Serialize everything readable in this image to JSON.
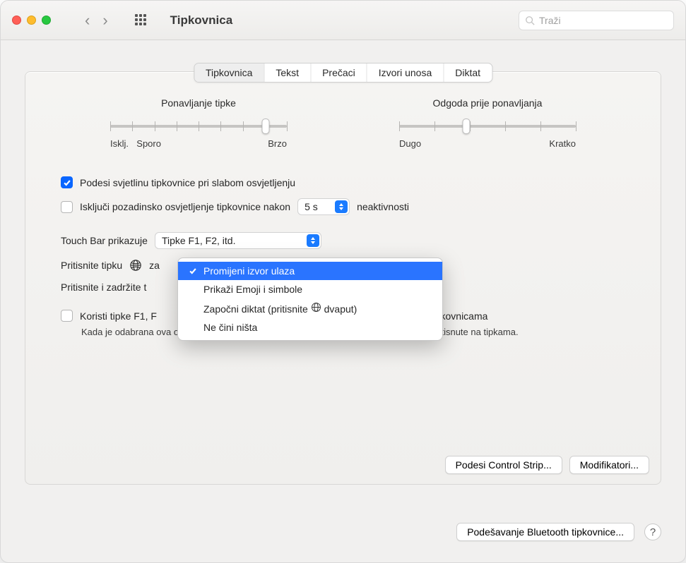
{
  "window": {
    "title": "Tipkovnica",
    "search_placeholder": "Traži"
  },
  "tabs": [
    {
      "label": "Tipkovnica",
      "active": true
    },
    {
      "label": "Tekst",
      "active": false
    },
    {
      "label": "Prečaci",
      "active": false
    },
    {
      "label": "Izvori unosa",
      "active": false
    },
    {
      "label": "Diktat",
      "active": false
    }
  ],
  "sliders": {
    "key_repeat": {
      "label": "Ponavljanje tipke",
      "min_label": "Isklj.",
      "mid_label": "Sporo",
      "max_label": "Brzo",
      "value_pct": 88
    },
    "delay": {
      "label": "Odgoda prije ponavljanja",
      "min_label": "Dugo",
      "max_label": "Kratko",
      "value_pct": 38
    }
  },
  "options": {
    "adjust_brightness": {
      "label": "Podesi svjetlinu tipkovnice pri slabom osvjetljenju",
      "checked": true
    },
    "turn_off_backlight": {
      "label_pre": "Isključi pozadinsko osvjetljenje tipkovnice nakon",
      "value": "5 s",
      "label_post": "neaktivnosti",
      "checked": false
    },
    "touch_bar": {
      "label": "Touch Bar prikazuje",
      "value": "Tipke F1, F2, itd."
    },
    "press_globe": {
      "label_pre": "Pritisnite tipku",
      "label_post": "za"
    },
    "press_hold": {
      "label": "Pritisnite i zadržite t"
    },
    "use_f_keys": {
      "label_visible_left": "Koristi tipke F1, F",
      "label_visible_right": "ksternim tipkovnicama",
      "checked": false,
      "desc": "Kada je odabrana ova opcija, pritisnite tipku Fn za korištenje posebnih značajki koje su otisnute na tipkama."
    }
  },
  "dropdown": {
    "items": [
      {
        "label": "Promijeni izvor ulaza",
        "selected": true
      },
      {
        "label": "Prikaži Emoji i simbole",
        "selected": false
      },
      {
        "label": "Započni diktat (pritisnite 🌐 dvaput)",
        "selected": false,
        "has_globe": true,
        "label_pre": "Započni diktat (pritisnite ",
        "label_post": " dvaput)"
      },
      {
        "label": "Ne čini ništa",
        "selected": false
      }
    ]
  },
  "buttons": {
    "control_strip": "Podesi Control Strip...",
    "modifiers": "Modifikatori...",
    "bluetooth": "Podešavanje Bluetooth tipkovnice..."
  }
}
